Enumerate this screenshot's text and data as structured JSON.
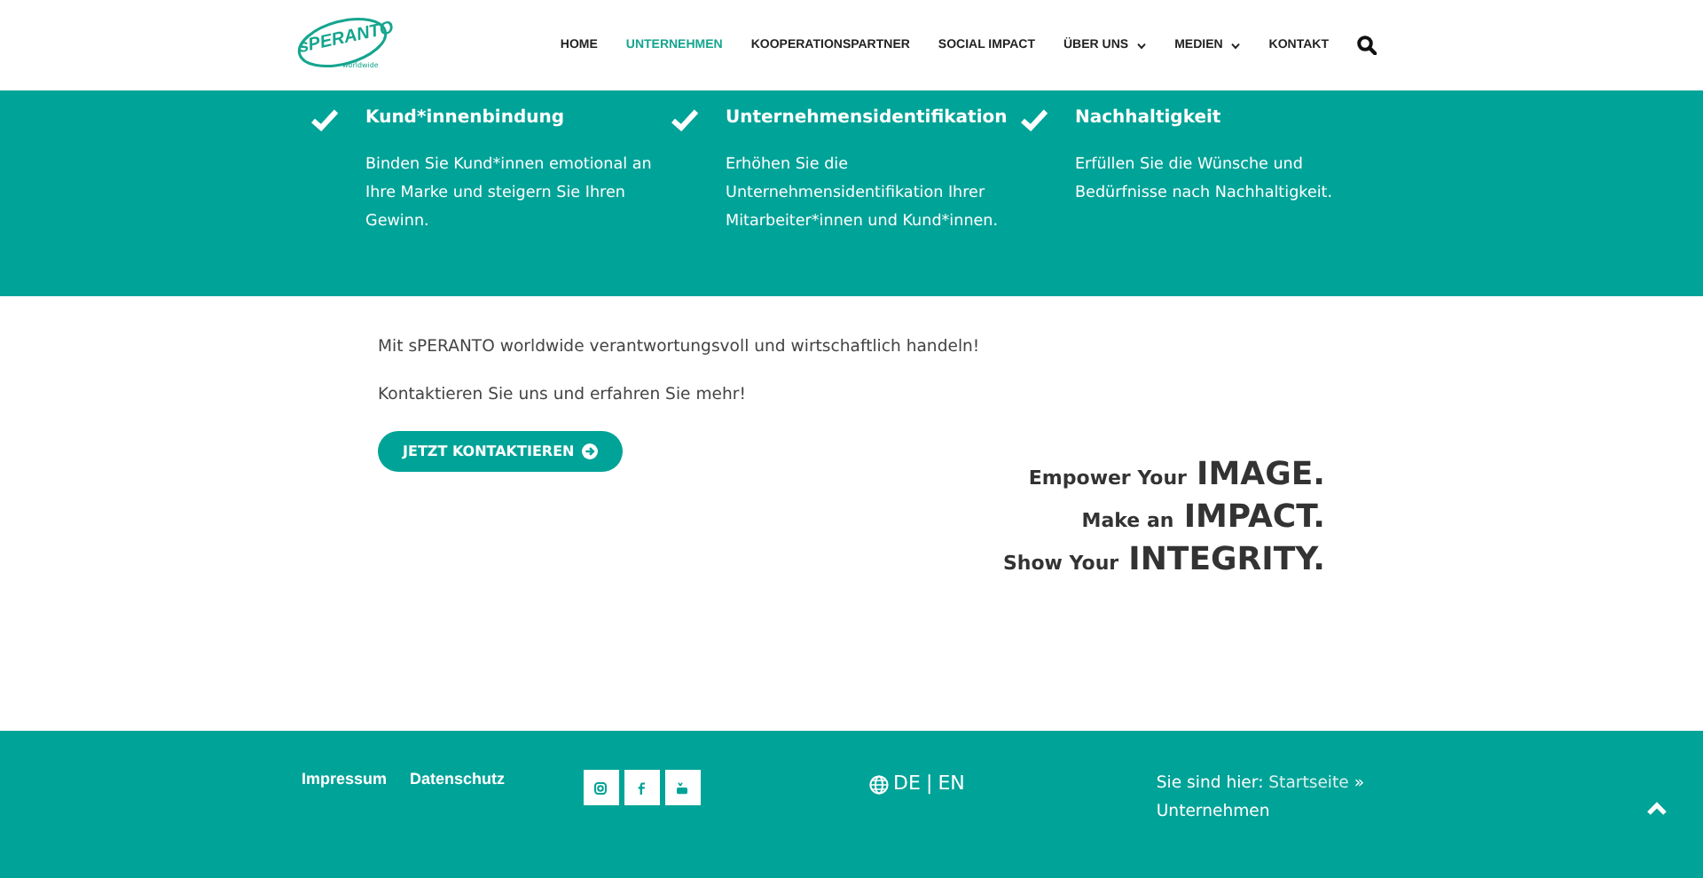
{
  "logo": {
    "name": "sPERANTO",
    "tagline": "worldwide"
  },
  "nav": [
    {
      "label": "HOME",
      "selected": false,
      "dropdown": false
    },
    {
      "label": "UNTERNEHMEN",
      "selected": true,
      "dropdown": false
    },
    {
      "label": "KOOPERATIONSPARTNER",
      "selected": false,
      "dropdown": false
    },
    {
      "label": "SOCIAL IMPACT",
      "selected": false,
      "dropdown": false
    },
    {
      "label": "ÜBER UNS",
      "selected": false,
      "dropdown": true
    },
    {
      "label": "MEDIEN",
      "selected": false,
      "dropdown": true
    },
    {
      "label": "KONTAKT",
      "selected": false,
      "dropdown": false
    }
  ],
  "features": [
    {
      "title": "Kund*innenbindung",
      "text": "Binden Sie Kund*innen emotional an Ihre Marke und steigern Sie Ihren Gewinn."
    },
    {
      "title": "Unternehmensidentifikation",
      "text": "Erhöhen Sie die Unternehmensidentifikation Ihrer Mitarbeiter*innen und Kund*innen."
    },
    {
      "title": "Nachhaltigkeit",
      "text": "Erfüllen Sie die Wünsche und Bedürfnisse nach Nachhaltigkeit."
    }
  ],
  "intro": [
    "Mit sPERANTO worldwide verantwortungsvoll und wirtschaftlich handeln!",
    "Kontaktieren Sie uns und erfahren Sie mehr!"
  ],
  "cta": {
    "label": "JETZT KONTAKTIEREN"
  },
  "slogan": [
    {
      "lead": "Empower Your",
      "emphasis": "IMAGE."
    },
    {
      "lead": "Make an",
      "emphasis": "IMPACT."
    },
    {
      "lead": "Show Your",
      "emphasis": "INTEGRITY."
    }
  ],
  "footer": {
    "links": [
      "Impressum",
      "Datenschutz"
    ],
    "social": [
      {
        "kind": "instagram"
      },
      {
        "kind": "facebook"
      },
      {
        "kind": "youtube"
      }
    ],
    "languages": [
      "DE",
      "EN"
    ],
    "language_separator": "|",
    "breadcrumb": {
      "label": "Sie sind hier:",
      "link": "Startseite",
      "separator": "»",
      "current": "Unternehmen"
    }
  }
}
